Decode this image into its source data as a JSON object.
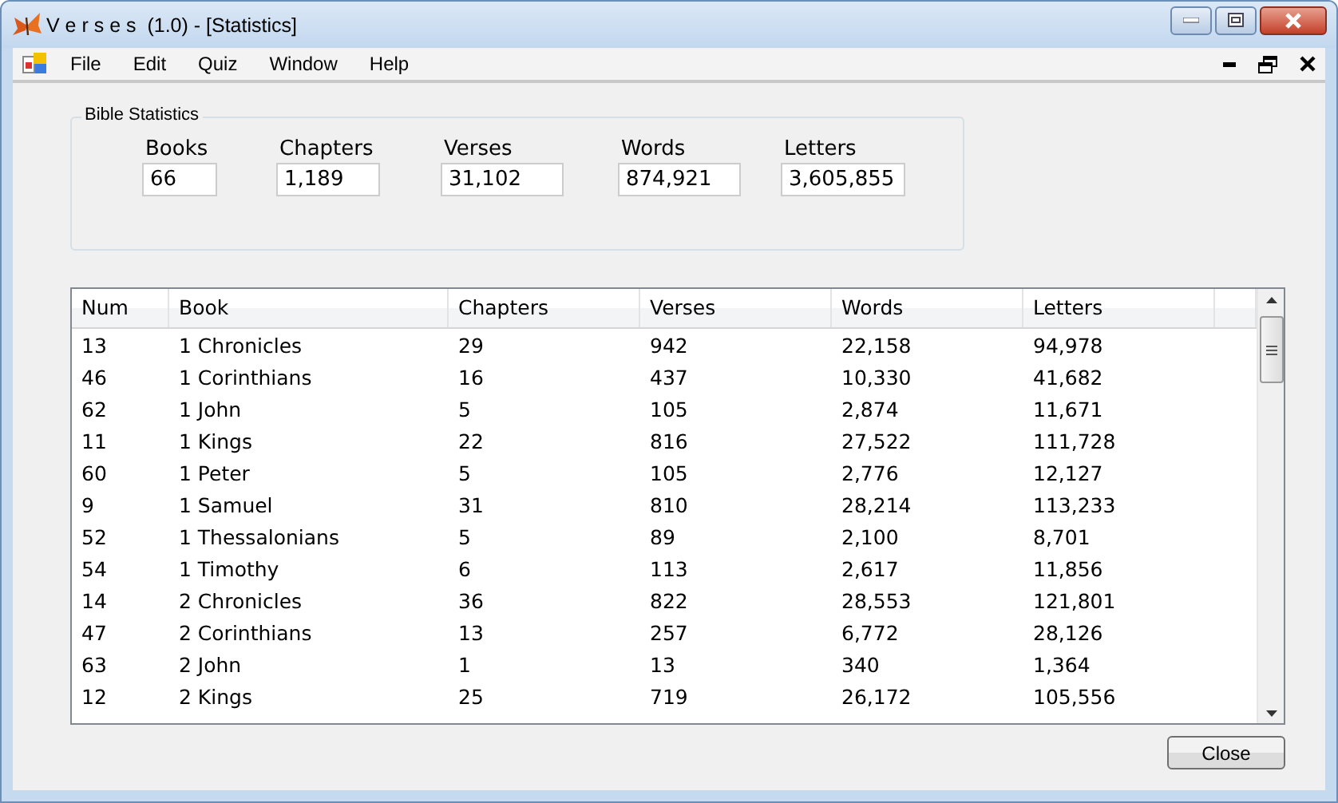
{
  "window": {
    "title": "V e r s e s  (1.0) - [Statistics]"
  },
  "menu": [
    "File",
    "Edit",
    "Quiz",
    "Window",
    "Help"
  ],
  "stats": {
    "title": "Bible Statistics",
    "fields": [
      {
        "label": "Books",
        "value": "66"
      },
      {
        "label": "Chapters",
        "value": "1,189"
      },
      {
        "label": "Verses",
        "value": "31,102"
      },
      {
        "label": "Words",
        "value": "874,921"
      },
      {
        "label": "Letters",
        "value": "3,605,855"
      }
    ]
  },
  "table": {
    "columns": [
      "Num",
      "Book",
      "Chapters",
      "Verses",
      "Words",
      "Letters"
    ],
    "rows": [
      [
        "13",
        "1 Chronicles",
        "29",
        "942",
        "22,158",
        "94,978"
      ],
      [
        "46",
        "1 Corinthians",
        "16",
        "437",
        "10,330",
        "41,682"
      ],
      [
        "62",
        "1 John",
        "5",
        "105",
        "2,874",
        "11,671"
      ],
      [
        "11",
        "1 Kings",
        "22",
        "816",
        "27,522",
        "111,728"
      ],
      [
        "60",
        "1 Peter",
        "5",
        "105",
        "2,776",
        "12,127"
      ],
      [
        "9",
        "1 Samuel",
        "31",
        "810",
        "28,214",
        "113,233"
      ],
      [
        "52",
        "1 Thessalonians",
        "5",
        "89",
        "2,100",
        "8,701"
      ],
      [
        "54",
        "1 Timothy",
        "6",
        "113",
        "2,617",
        "11,856"
      ],
      [
        "14",
        "2 Chronicles",
        "36",
        "822",
        "28,553",
        "121,801"
      ],
      [
        "47",
        "2 Corinthians",
        "13",
        "257",
        "6,772",
        "28,126"
      ],
      [
        "63",
        "2 John",
        "1",
        "13",
        "340",
        "1,364"
      ],
      [
        "12",
        "2 Kings",
        "25",
        "719",
        "26,172",
        "105,556"
      ]
    ]
  },
  "buttons": [
    "Close"
  ]
}
